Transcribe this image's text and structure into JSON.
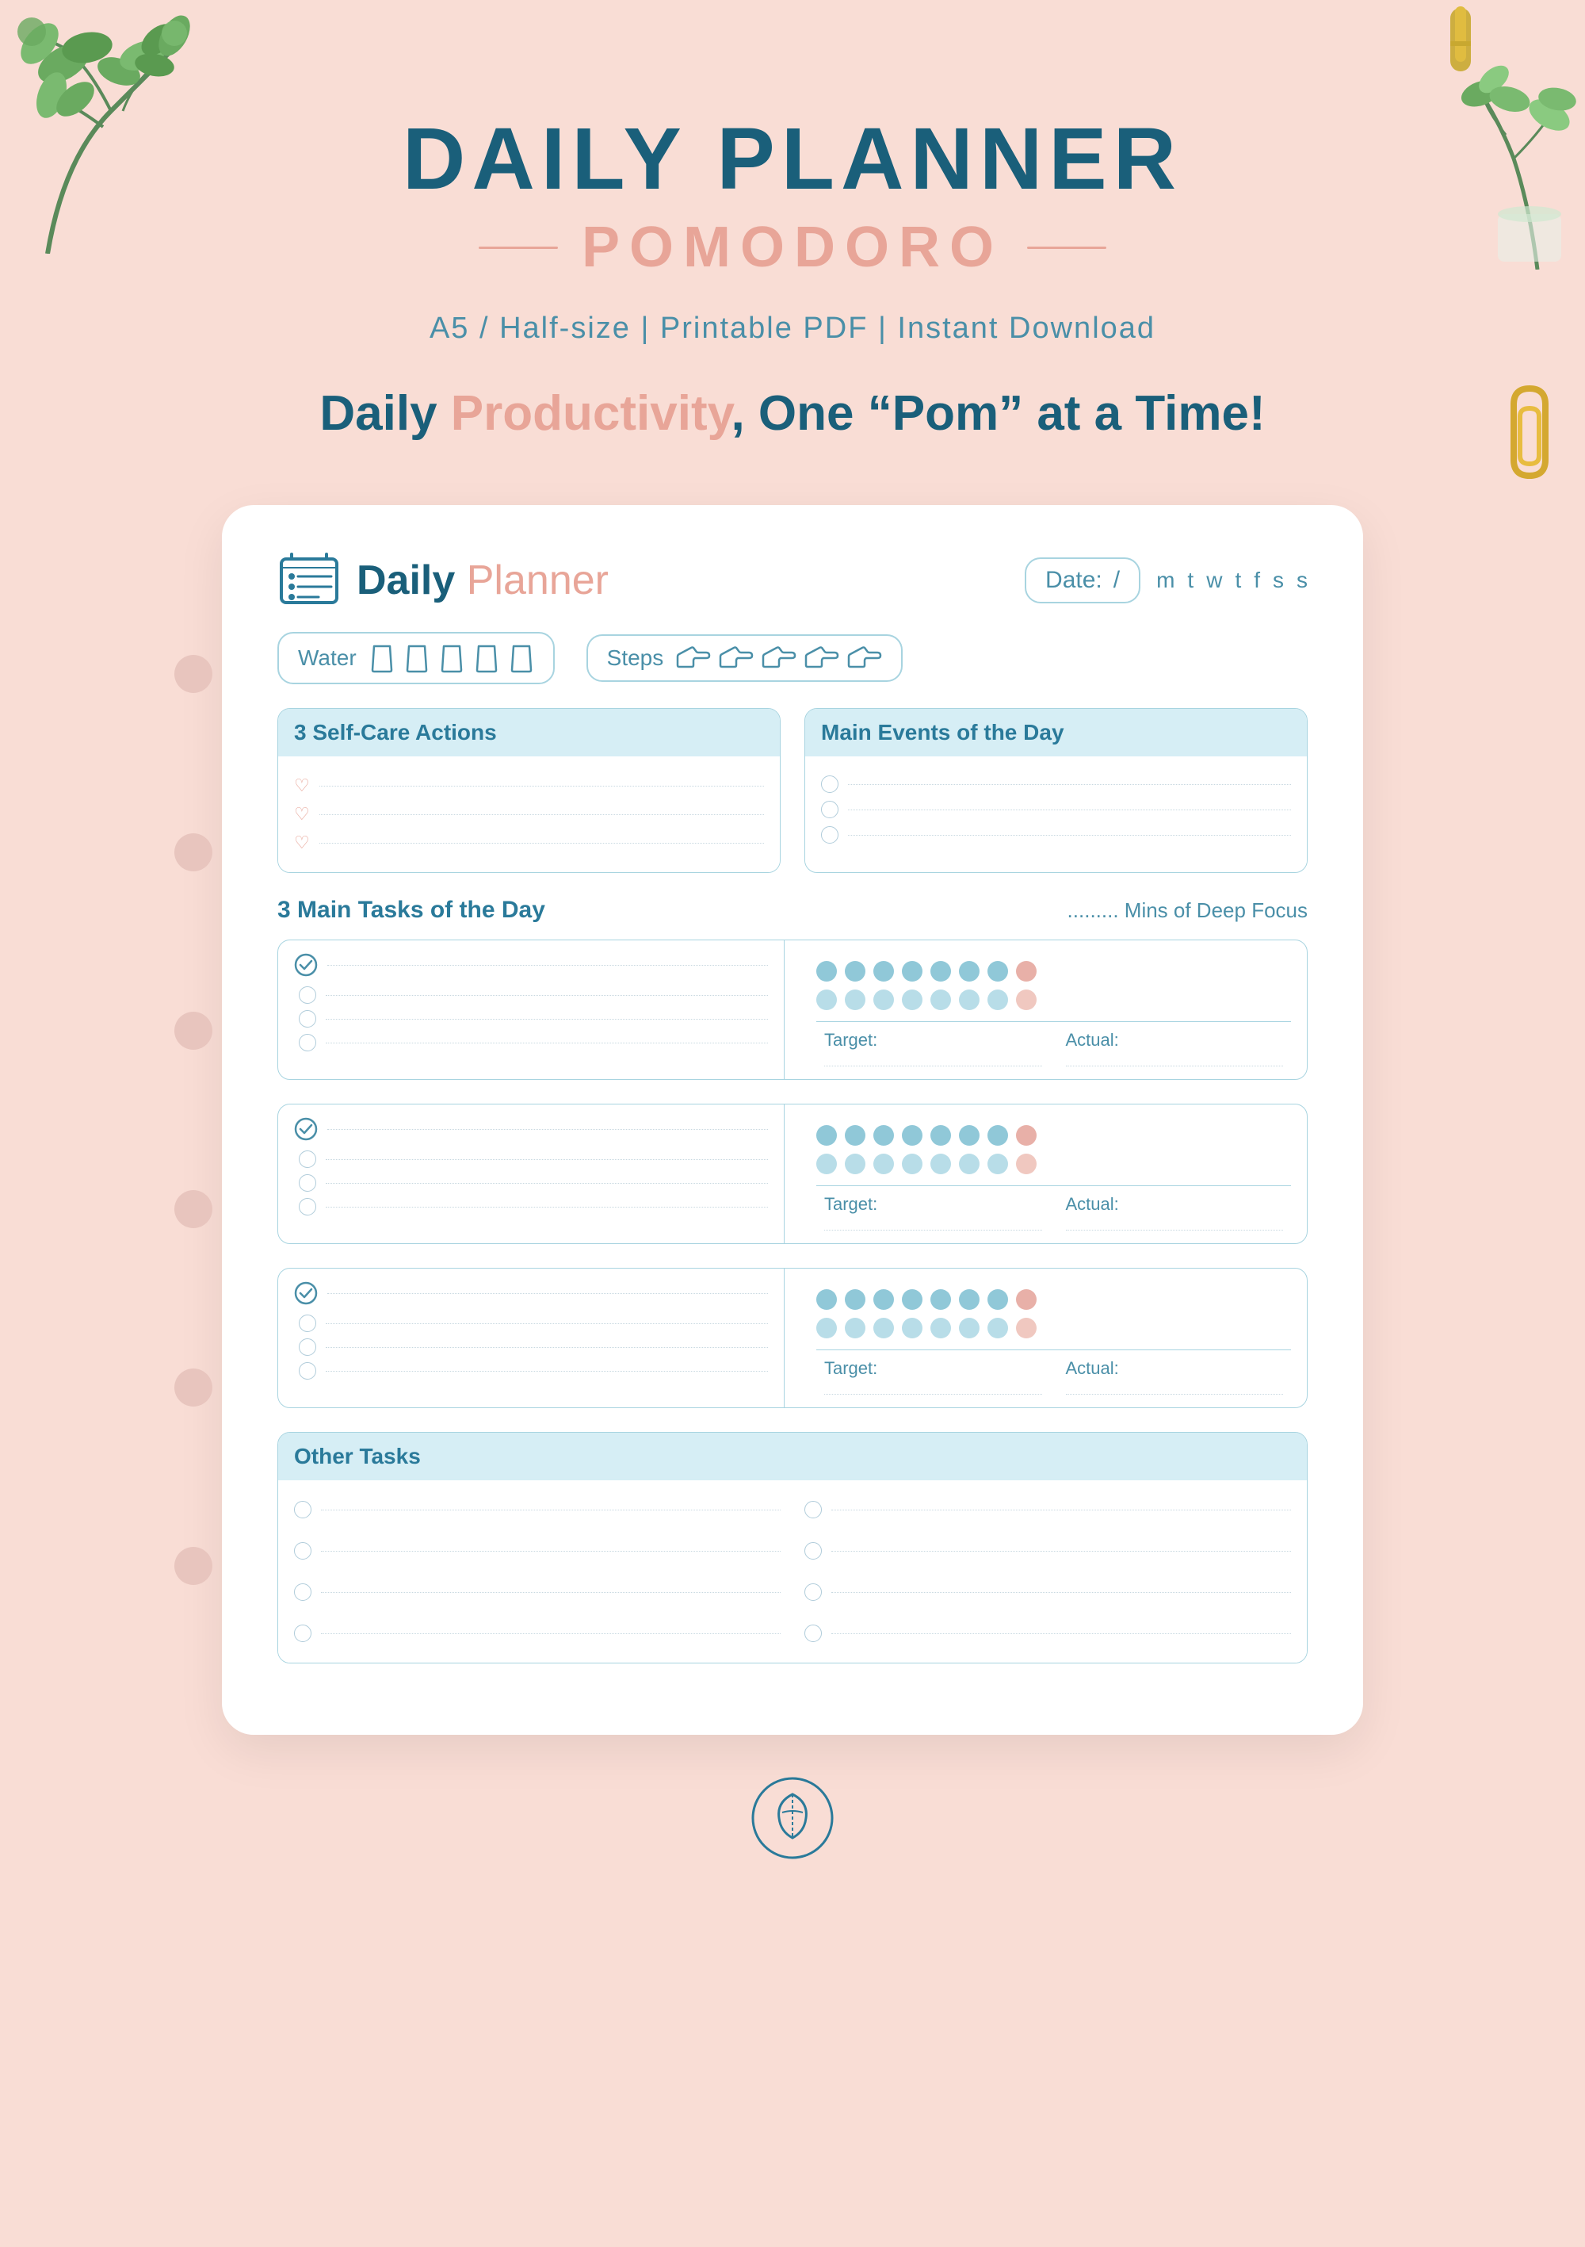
{
  "background_color": "#f9ddd5",
  "header": {
    "title_line1": "DAILY PLANNER",
    "title_line2": "POMODORO",
    "subtitle": "A5 / Half-size   |   Printable PDF   |   Instant Download",
    "tagline_part1": "Daily ",
    "tagline_part2": "Productivity",
    "tagline_part3": ", One “Pom” at a Time!"
  },
  "planner": {
    "logo_text_daily": "Daily",
    "logo_text_planner": "Planner",
    "date_label": "Date:",
    "date_slash": "/",
    "days": [
      "m",
      "t",
      "w",
      "t",
      "f",
      "s",
      "s"
    ],
    "water_label": "Water",
    "steps_label": "Steps",
    "self_care_title": "3 Self-Care Actions",
    "self_care_lines": 3,
    "main_events_title": "Main Events of the Day",
    "main_events_lines": 3,
    "main_tasks_title": "3 Main Tasks of the Day",
    "deep_focus_label": "......... Mins of Deep Focus",
    "tasks": [
      {
        "main_line": true,
        "sub_lines": 3,
        "dots_row1": [
          "blue",
          "blue",
          "blue",
          "blue",
          "blue",
          "blue",
          "blue",
          "pink"
        ],
        "dots_row2": [
          "light-blue",
          "light-blue",
          "light-blue",
          "light-blue",
          "light-blue",
          "light-blue",
          "light-blue",
          "light-pink"
        ],
        "target_label": "Target:",
        "actual_label": "Actual:"
      },
      {
        "main_line": true,
        "sub_lines": 3,
        "dots_row1": [
          "blue",
          "blue",
          "blue",
          "blue",
          "blue",
          "blue",
          "blue",
          "pink"
        ],
        "dots_row2": [
          "light-blue",
          "light-blue",
          "light-blue",
          "light-blue",
          "light-blue",
          "light-blue",
          "light-blue",
          "light-pink"
        ],
        "target_label": "Target:",
        "actual_label": "Actual:"
      },
      {
        "main_line": true,
        "sub_lines": 3,
        "dots_row1": [
          "blue",
          "blue",
          "blue",
          "blue",
          "blue",
          "blue",
          "blue",
          "pink"
        ],
        "dots_row2": [
          "light-blue",
          "light-blue",
          "light-blue",
          "light-blue",
          "light-blue",
          "light-blue",
          "light-blue",
          "light-pink"
        ],
        "target_label": "Target:",
        "actual_label": "Actual:"
      }
    ],
    "other_tasks_title": "Other Tasks",
    "other_tasks_count": 4,
    "other_tasks_count_right": 4
  },
  "accent_colors": {
    "blue": "#1a5f7a",
    "pink": "#e8a598",
    "light_blue": "#4a8fa8",
    "section_bg": "#d6eef5",
    "border": "#a8d4e0"
  }
}
